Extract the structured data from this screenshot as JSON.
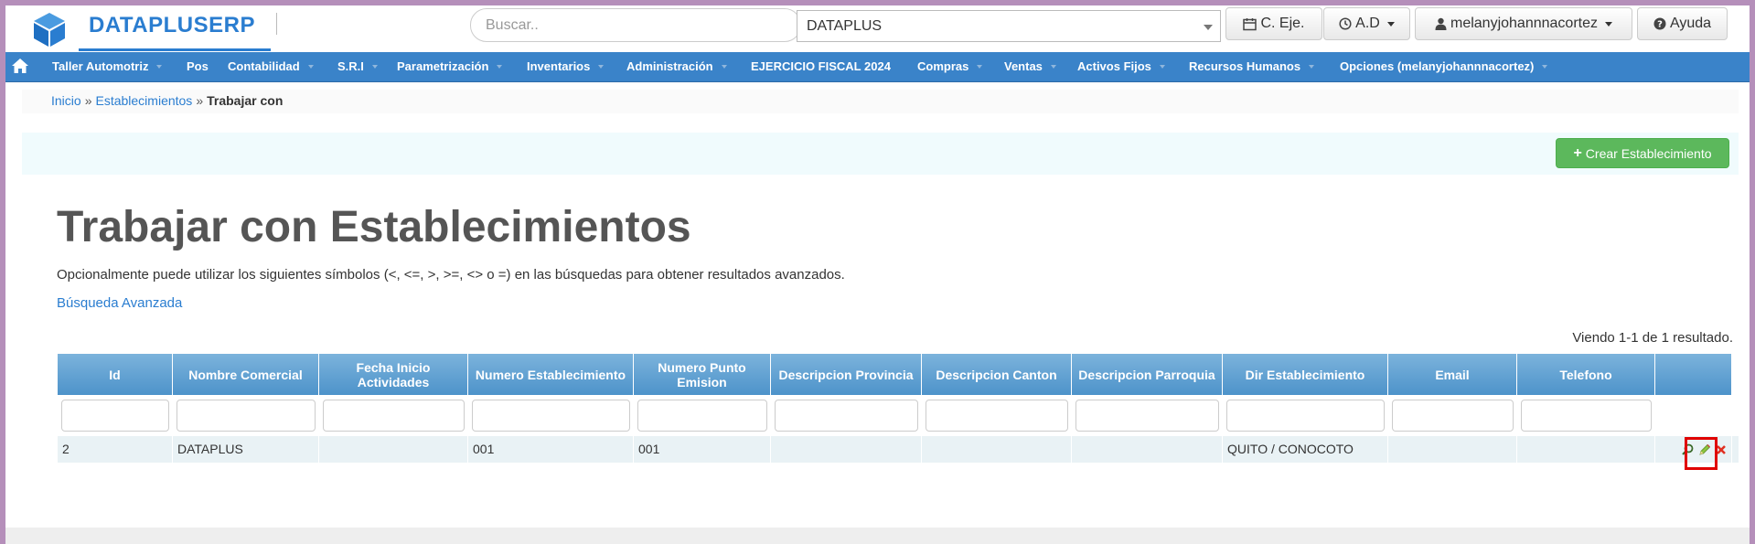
{
  "header": {
    "brand": "DATAPLUSERP",
    "search_placeholder": "Buscar..",
    "company_selected": "DATAPLUS",
    "btn_ejercicio": "C. Eje.",
    "btn_ad": "A.D",
    "btn_user": "melanyjohannnacortez",
    "btn_help": "Ayuda"
  },
  "nav": {
    "items": [
      {
        "label": "Taller Automotriz",
        "caret": true
      },
      {
        "label": "Pos",
        "caret": false
      },
      {
        "label": "Contabilidad",
        "caret": true
      },
      {
        "label": "S.R.I",
        "caret": true
      },
      {
        "label": "Parametrización",
        "caret": true
      },
      {
        "label": "Inventarios",
        "caret": true
      },
      {
        "label": "Administración",
        "caret": true
      },
      {
        "label": "EJERCICIO FISCAL 2024",
        "caret": false
      },
      {
        "label": "Compras",
        "caret": true
      },
      {
        "label": "Ventas",
        "caret": true
      },
      {
        "label": "Activos Fijos",
        "caret": true
      },
      {
        "label": "Recursos Humanos",
        "caret": true
      },
      {
        "label": "Opciones (melanyjohannnacortez)",
        "caret": true
      }
    ]
  },
  "breadcrumb": {
    "home": "Inicio",
    "sep1": "»",
    "section": "Establecimientos",
    "sep2": "»",
    "current": "Trabajar con"
  },
  "actions": {
    "create_label": "Crear Establecimiento"
  },
  "page": {
    "title": "Trabajar con Establecimientos",
    "hint": "Opcionalmente puede utilizar los siguientes símbolos (<, <=, >, >=, <> o =) en las búsquedas para obtener resultados avanzados.",
    "advanced_search": "Búsqueda Avanzada",
    "summary": "Viendo 1-1 de 1 resultado."
  },
  "table": {
    "columns": [
      "Id",
      "Nombre Comercial",
      "Fecha Inicio Actividades",
      "Numero Establecimiento",
      "Numero Punto Emision",
      "Descripcion Provincia",
      "Descripcion Canton",
      "Descripcion Parroquia",
      "Dir Establecimiento",
      "Email",
      "Telefono",
      ""
    ],
    "rows": [
      [
        "2",
        "DATAPLUS",
        "",
        "001",
        "001",
        "",
        "",
        "",
        "QUITO / CONOCOTO",
        "",
        "",
        ""
      ]
    ]
  },
  "colors": {
    "brand": "#2a7dd0",
    "navbar": "#3a83c9",
    "create_button": "#5cb85c",
    "highlight": "#e00000"
  },
  "icons": {
    "logo": "cube-logo-icon",
    "home": "home-icon",
    "calendar": "calendar-icon",
    "clock": "clock-icon",
    "user": "user-icon",
    "help": "question-circle-icon",
    "plus": "plus-icon",
    "view": "magnifier-icon",
    "edit": "pencil-icon",
    "delete": "delete-x-icon"
  }
}
